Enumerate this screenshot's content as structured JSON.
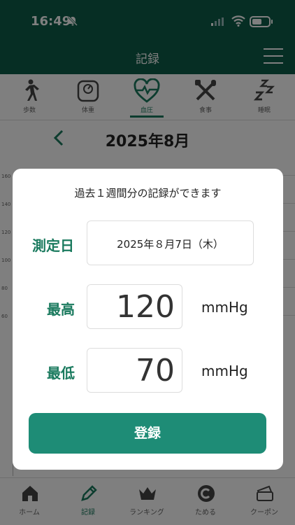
{
  "status_bar": {
    "time": "16:49",
    "icons": [
      "bell-slash-icon",
      "signal-icon",
      "wifi-icon",
      "battery-icon"
    ]
  },
  "header": {
    "title": "記録",
    "menu_icon": "hamburger-menu-icon"
  },
  "category_tabs": [
    {
      "label": "歩数",
      "icon": "walking-icon"
    },
    {
      "label": "体重",
      "icon": "scale-icon"
    },
    {
      "label": "血圧",
      "icon": "heart-pulse-icon",
      "active": true
    },
    {
      "label": "食事",
      "icon": "fork-knife-icon"
    },
    {
      "label": "睡眠",
      "icon": "sleep-zzz-icon"
    }
  ],
  "month_nav": {
    "prev_icon": "chevron-left-icon",
    "month": "2025年8月"
  },
  "chart_axis_ticks": [
    "160",
    "140",
    "120",
    "100",
    "80",
    "60"
  ],
  "bottom_nav": [
    {
      "label": "ホーム",
      "icon": "home-icon"
    },
    {
      "label": "記録",
      "icon": "pencil-icon",
      "active": true
    },
    {
      "label": "ランキング",
      "icon": "crown-icon"
    },
    {
      "label": "ためる",
      "icon": "coin-icon"
    },
    {
      "label": "クーポン",
      "icon": "coupon-icon"
    }
  ],
  "modal": {
    "heading": "過去１週間分の記録ができます",
    "date_label": "測定日",
    "date_value": "2025年８月7日（木）",
    "systolic_label": "最高",
    "systolic_value": "120",
    "systolic_unit": "mmHg",
    "diastolic_label": "最低",
    "diastolic_value": "70",
    "diastolic_unit": "mmHg",
    "submit_label": "登録"
  },
  "colors": {
    "header_bg": "#0c5c48",
    "accent": "#1a7a5e",
    "button": "#1e8c76"
  }
}
